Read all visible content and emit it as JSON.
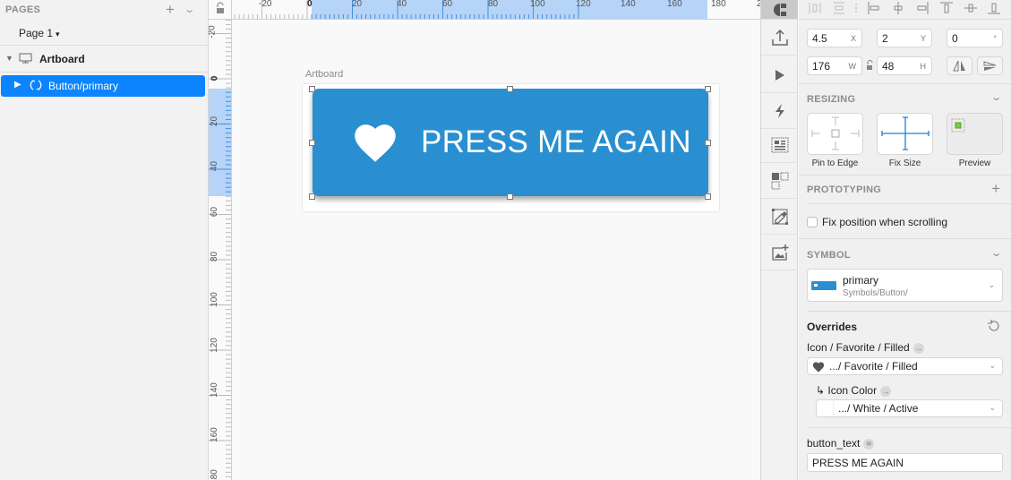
{
  "left_panel": {
    "pages_header": "PAGES",
    "current_page": "Page 1",
    "layers": [
      {
        "label": "Artboard",
        "type": "artboard",
        "expanded": true
      },
      {
        "label": "Button/primary",
        "type": "symbol",
        "selected": true
      }
    ]
  },
  "rulers": {
    "horizontal_labels": [
      "-20",
      "0",
      "20",
      "40",
      "60",
      "80",
      "100",
      "120",
      "140",
      "160",
      "180",
      "2"
    ],
    "vertical_labels": [
      "-20",
      "0",
      "20",
      "40",
      "60",
      "80",
      "100",
      "120",
      "140",
      "160",
      "180"
    ]
  },
  "canvas": {
    "artboard_label": "Artboard",
    "button_text": "PRESS ME AGAIN",
    "button_color": "#2a8fd0",
    "button_icon": "heart-icon"
  },
  "toolbar": {
    "tools": [
      "inspector",
      "export",
      "preview",
      "prototype",
      "layout",
      "symbols",
      "edit",
      "add-image"
    ]
  },
  "inspector": {
    "x": "4.5",
    "x_label": "X",
    "y": "2",
    "y_label": "Y",
    "rotation": "0",
    "rotation_label": "°",
    "width": "176",
    "width_label": "W",
    "height": "48",
    "height_label": "H",
    "resizing": {
      "title": "RESIZING",
      "options": [
        "Pin to Edge",
        "Fix Size",
        "Preview"
      ]
    },
    "prototyping": {
      "title": "PROTOTYPING",
      "fix_position_label": "Fix position when scrolling",
      "fix_position_checked": false
    },
    "symbol": {
      "title": "SYMBOL",
      "name": "primary",
      "path": "Symbols/Button/"
    },
    "overrides": {
      "title": "Overrides",
      "icon_label": "Icon / Favorite / Filled",
      "icon_value": ".../ Favorite / Filled",
      "icon_color_label": "↳ Icon Color",
      "icon_color_value": ".../ White / Active",
      "text_label": "button_text",
      "text_value": "PRESS ME AGAIN"
    }
  }
}
